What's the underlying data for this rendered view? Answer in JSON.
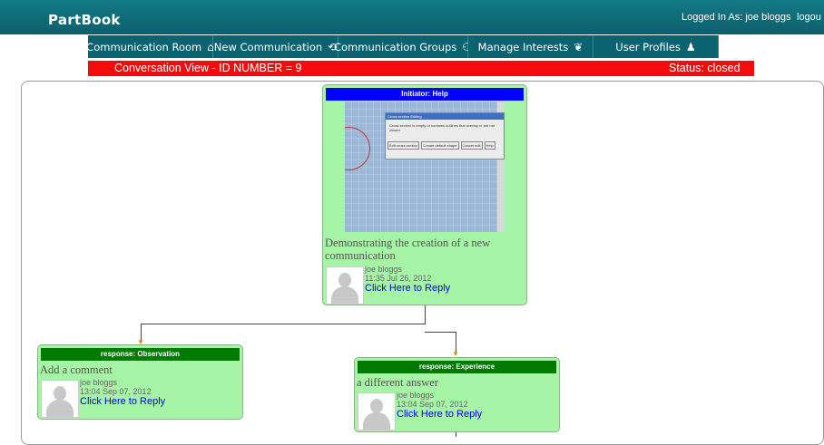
{
  "app": {
    "title": "PartBook",
    "logged_in": "Logged In As: joe bloggs",
    "logout": "logou"
  },
  "nav": [
    {
      "label": "Communication Room",
      "icon": "⌂"
    },
    {
      "label": "New Communication",
      "icon": "⟲"
    },
    {
      "label": "Communication Groups",
      "icon": "⚇"
    },
    {
      "label": "Manage Interests",
      "icon": "❦"
    },
    {
      "label": "User Profiles",
      "icon": "♟"
    }
  ],
  "conversation": {
    "title": "Conversation View - ID NUMBER = 9",
    "status": "Status: closed"
  },
  "initiator": {
    "header": "Initiator: Help",
    "text": "Demonstrating the creation of a new communication",
    "user": "joe bloggs",
    "time": "11:35 Jul 26, 2012",
    "reply": "Click Here to Reply",
    "screenshot": {
      "dialog_title": "Cross section Editing",
      "dialog_msg": "Cross section is empty or contains outlines that overlap or are not closed",
      "btn1": "Edit cross section",
      "btn2": "Create default shape",
      "btn3": "Cancel edit",
      "btn4": "Help"
    }
  },
  "responses": [
    {
      "header": "response: Observation",
      "text": "Add a comment",
      "user": "joe bloggs",
      "time": "13:04 Sep 07, 2012",
      "reply": "Click Here to Reply"
    },
    {
      "header": "response: Experience",
      "text": "a different answer",
      "user": "joe bloggs",
      "time": "13:04 Sep 07, 2012",
      "reply": "Click Here to Reply"
    }
  ],
  "colors": {
    "teal": "#0c6370",
    "red": "#f20c0c",
    "card": "#a6f5a6",
    "initiator_hdr": "#0000ff",
    "response_hdr": "#007a00"
  }
}
